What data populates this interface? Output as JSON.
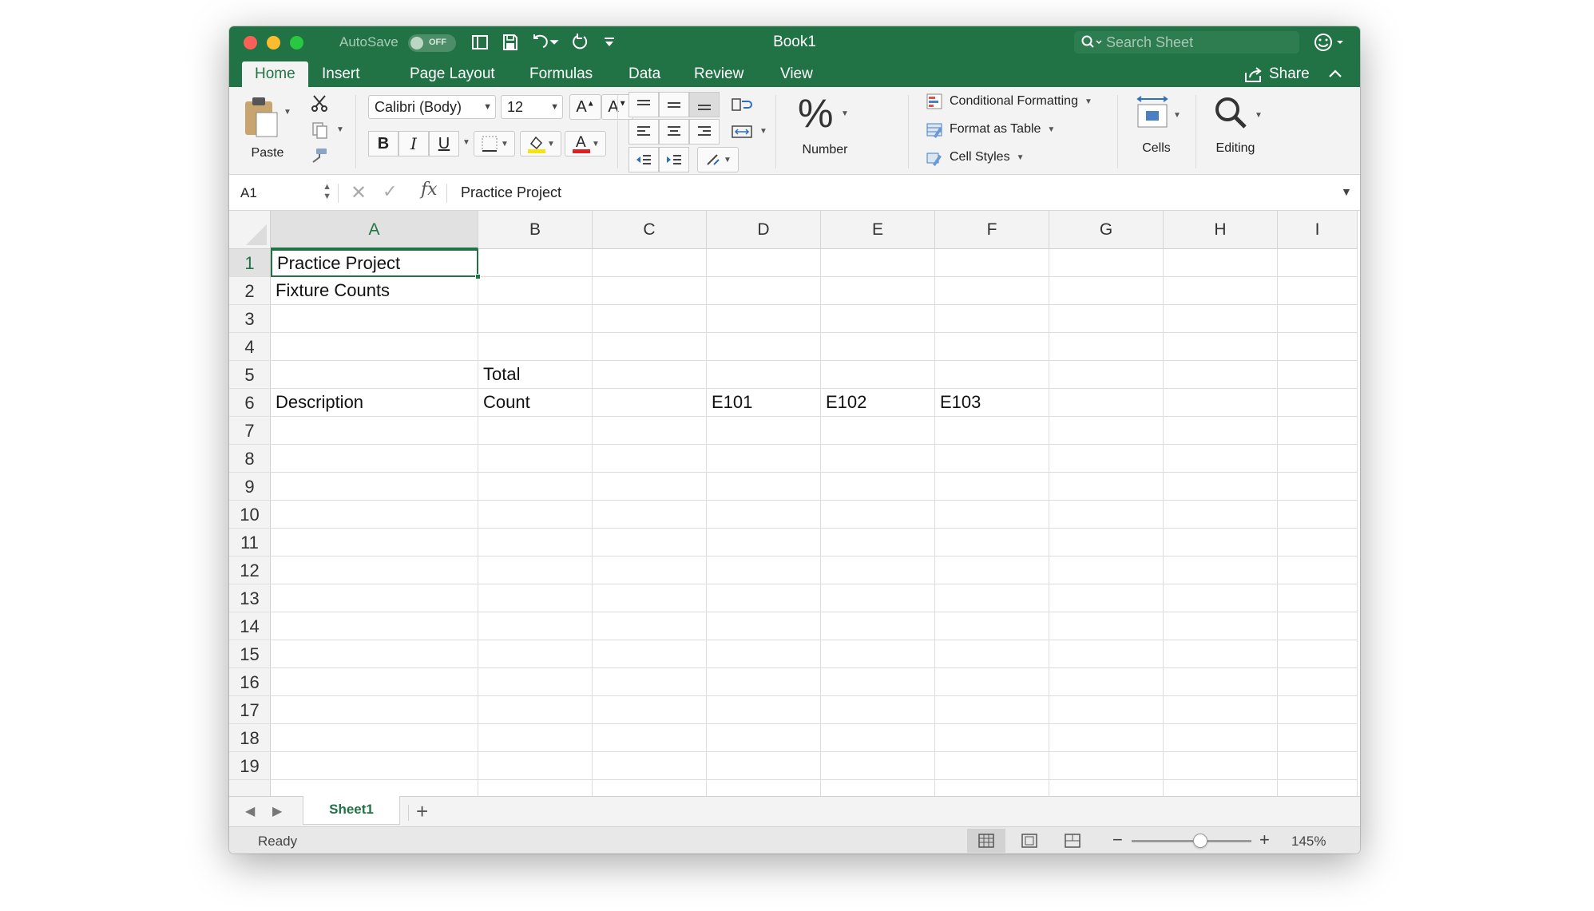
{
  "window": {
    "title": "Book1",
    "autosave_label": "AutoSave",
    "autosave_state": "OFF",
    "search_placeholder": "Search Sheet"
  },
  "tabs": [
    {
      "label": "Home",
      "active": true
    },
    {
      "label": "Insert"
    },
    {
      "label": "Page Layout"
    },
    {
      "label": "Formulas"
    },
    {
      "label": "Data"
    },
    {
      "label": "Review"
    },
    {
      "label": "View"
    }
  ],
  "share_label": "Share",
  "ribbon": {
    "paste_label": "Paste",
    "font_name": "Calibri (Body)",
    "font_size": "12",
    "bold": "B",
    "italic": "I",
    "underline": "U",
    "number_label": "Number",
    "number_symbol": "%",
    "conditional_formatting": "Conditional Formatting",
    "format_as_table": "Format as Table",
    "cell_styles": "Cell Styles",
    "cells_label": "Cells",
    "editing_label": "Editing"
  },
  "formula_bar": {
    "name_box": "A1",
    "fx": "fx",
    "content": "Practice Project"
  },
  "columns": [
    "A",
    "B",
    "C",
    "D",
    "E",
    "F",
    "G",
    "H",
    "I"
  ],
  "rows": [
    "1",
    "2",
    "3",
    "4",
    "5",
    "6",
    "7",
    "8",
    "9",
    "10",
    "11",
    "12",
    "13",
    "14",
    "15",
    "16",
    "17",
    "18",
    "19"
  ],
  "cells": {
    "A1": "Practice Project",
    "A2": "Fixture Counts",
    "B5": "Total",
    "A6": "Description",
    "B6": "Count",
    "D6": "E101",
    "E6": "E102",
    "F6": "E103"
  },
  "active_cell": "A1",
  "sheets": [
    {
      "label": "Sheet1",
      "active": true
    }
  ],
  "status": {
    "text": "Ready",
    "zoom": "145%",
    "zoom_percent": 145
  },
  "colors": {
    "accent": "#217346",
    "close": "#fc5f57",
    "minimize": "#fdbc2e",
    "maximize": "#28c840"
  }
}
